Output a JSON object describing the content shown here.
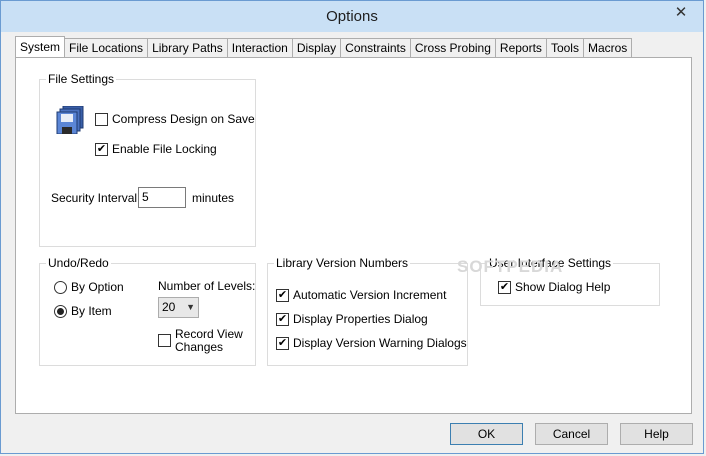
{
  "window": {
    "title": "Options"
  },
  "tabs": [
    "System",
    "File Locations",
    "Library Paths",
    "Interaction",
    "Display",
    "Constraints",
    "Cross Probing",
    "Reports",
    "Tools",
    "Macros"
  ],
  "file_settings": {
    "legend": "File Settings",
    "compress_label": "Compress Design on Save",
    "compress_checked": false,
    "file_locking_label": "Enable File Locking",
    "file_locking_checked": true,
    "security_interval_label": "Security Interval:",
    "security_interval_value": "5",
    "minutes_label": "minutes"
  },
  "undo_redo": {
    "legend": "Undo/Redo",
    "by_option_label": "By Option",
    "by_item_label": "By Item",
    "selected": "By Item",
    "levels_label": "Number of Levels:",
    "levels_value": "20",
    "record_view_line1": "Record View",
    "record_view_line2": "Changes",
    "record_view_checked": false
  },
  "library_version": {
    "legend": "Library Version Numbers",
    "auto_increment_label": "Automatic Version Increment",
    "display_props_label": "Display Properties Dialog",
    "display_warning_label": "Display Version Warning Dialogs"
  },
  "ui_settings": {
    "legend": "User Interface Settings",
    "show_help_label": "Show Dialog Help"
  },
  "watermark": "SOFTPEDIA",
  "buttons": {
    "ok": "OK",
    "cancel": "Cancel",
    "help": "Help"
  },
  "icons": {
    "close": "close-icon",
    "disk": "floppy-disk-icon"
  }
}
